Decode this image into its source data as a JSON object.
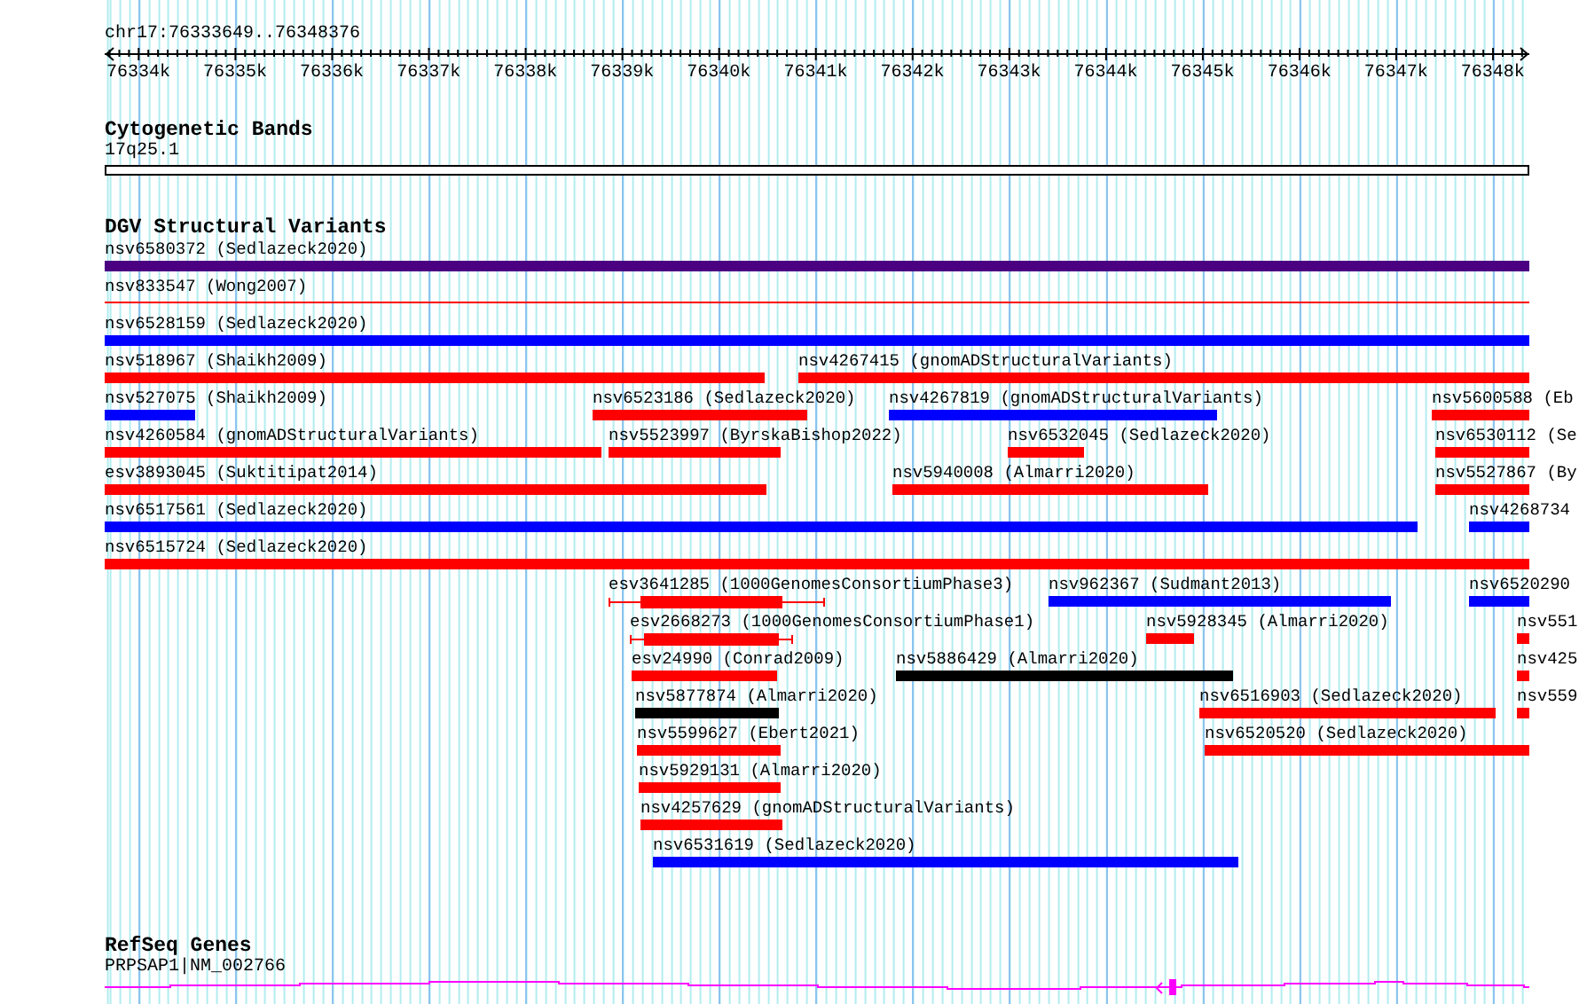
{
  "ruler": {
    "location": "chr17:76333649..76348376",
    "ticks": [
      "76334k",
      "76335k",
      "76336k",
      "76337k",
      "76338k",
      "76339k",
      "76340k",
      "76341k",
      "76342k",
      "76343k",
      "76344k",
      "76345k",
      "76346k",
      "76347k",
      "76348k"
    ]
  },
  "bands": {
    "title": "Cytogenetic Bands",
    "label": "17q25.1"
  },
  "variants": {
    "title": "DGV Structural Variants",
    "lanes": [
      {
        "features": [
          {
            "label": "nsv6580372 (Sedlazeck2020)",
            "color": "#4b0082",
            "kind": "bar"
          }
        ]
      },
      {
        "features": [
          {
            "label": "nsv833547 (Wong2007)",
            "color": "#ff0000",
            "kind": "line"
          }
        ]
      },
      {
        "features": [
          {
            "label": "nsv6528159 (Sedlazeck2020)",
            "color": "#0000ff",
            "kind": "bar"
          }
        ]
      },
      {
        "features": [
          {
            "label": "nsv518967 (Shaikh2009)",
            "color": "#ff0000",
            "kind": "bar"
          },
          {
            "label": "nsv4267415 (gnomADStructuralVariants)",
            "color": "#ff0000",
            "kind": "bar"
          }
        ]
      },
      {
        "features": [
          {
            "label": "nsv527075 (Shaikh2009)",
            "color": "#0000ff",
            "kind": "bar"
          },
          {
            "label": "nsv6523186 (Sedlazeck2020)",
            "color": "#ff0000",
            "kind": "bar"
          },
          {
            "label": "nsv4267819 (gnomADStructuralVariants)",
            "color": "#0000ff",
            "kind": "bar"
          },
          {
            "label": "nsv5600588 (Eb",
            "color": "#ff0000",
            "kind": "bar"
          }
        ]
      },
      {
        "features": [
          {
            "label": "nsv4260584 (gnomADStructuralVariants)",
            "color": "#ff0000",
            "kind": "bar"
          },
          {
            "label": "nsv5523997 (ByrskaBishop2022)",
            "color": "#ff0000",
            "kind": "bar"
          },
          {
            "label": "nsv6532045 (Sedlazeck2020)",
            "color": "#ff0000",
            "kind": "bar"
          },
          {
            "label": "nsv6530112 (Se",
            "color": "#ff0000",
            "kind": "bar"
          }
        ]
      },
      {
        "features": [
          {
            "label": "esv3893045 (Suktitipat2014)",
            "color": "#ff0000",
            "kind": "bar"
          },
          {
            "label": "nsv5940008 (Almarri2020)",
            "color": "#ff0000",
            "kind": "bar"
          },
          {
            "label": "nsv5527867 (By",
            "color": "#ff0000",
            "kind": "bar"
          }
        ]
      },
      {
        "features": [
          {
            "label": "nsv6517561 (Sedlazeck2020)",
            "color": "#0000ff",
            "kind": "bar"
          },
          {
            "label": "nsv4268734",
            "color": "#0000ff",
            "kind": "bar"
          }
        ]
      },
      {
        "features": [
          {
            "label": "nsv6515724 (Sedlazeck2020)",
            "color": "#ff0000",
            "kind": "bar"
          }
        ]
      },
      {
        "features": [
          {
            "label": "esv3641285 (1000GenomesConsortiumPhase3)",
            "color": "#ff0000",
            "kind": "whisker"
          },
          {
            "label": "nsv962367 (Sudmant2013)",
            "color": "#0000ff",
            "kind": "bar"
          },
          {
            "label": "nsv6520290",
            "color": "#0000ff",
            "kind": "bar"
          }
        ]
      },
      {
        "features": [
          {
            "label": "esv2668273 (1000GenomesConsortiumPhase1)",
            "color": "#ff0000",
            "kind": "whisker"
          },
          {
            "label": "nsv5928345 (Almarri2020)",
            "color": "#ff0000",
            "kind": "bar"
          },
          {
            "label": "nsv551",
            "color": "#ff0000",
            "kind": "bar"
          }
        ]
      },
      {
        "features": [
          {
            "label": "esv24990 (Conrad2009)",
            "color": "#ff0000",
            "kind": "bar"
          },
          {
            "label": "nsv5886429 (Almarri2020)",
            "color": "#000000",
            "kind": "bar"
          },
          {
            "label": "nsv425",
            "color": "#ff0000",
            "kind": "bar"
          }
        ]
      },
      {
        "features": [
          {
            "label": "nsv5877874 (Almarri2020)",
            "color": "#000000",
            "kind": "bar"
          },
          {
            "label": "nsv6516903 (Sedlazeck2020)",
            "color": "#ff0000",
            "kind": "bar"
          },
          {
            "label": "nsv559",
            "color": "#ff0000",
            "kind": "bar"
          }
        ]
      },
      {
        "features": [
          {
            "label": "nsv5599627 (Ebert2021)",
            "color": "#ff0000",
            "kind": "bar"
          },
          {
            "label": "nsv6520520 (Sedlazeck2020)",
            "color": "#ff0000",
            "kind": "bar"
          }
        ]
      },
      {
        "features": [
          {
            "label": "nsv5929131 (Almarri2020)",
            "color": "#ff0000",
            "kind": "bar"
          }
        ]
      },
      {
        "features": [
          {
            "label": "nsv4257629 (gnomADStructuralVariants)",
            "color": "#ff0000",
            "kind": "bar"
          }
        ]
      },
      {
        "features": [
          {
            "label": "nsv6531619 (Sedlazeck2020)",
            "color": "#0000ff",
            "kind": "bar"
          }
        ]
      }
    ]
  },
  "genes": {
    "title": "RefSeq Genes",
    "label": "PRPSAP1|NM_002766",
    "color": "#ff00ff"
  }
}
